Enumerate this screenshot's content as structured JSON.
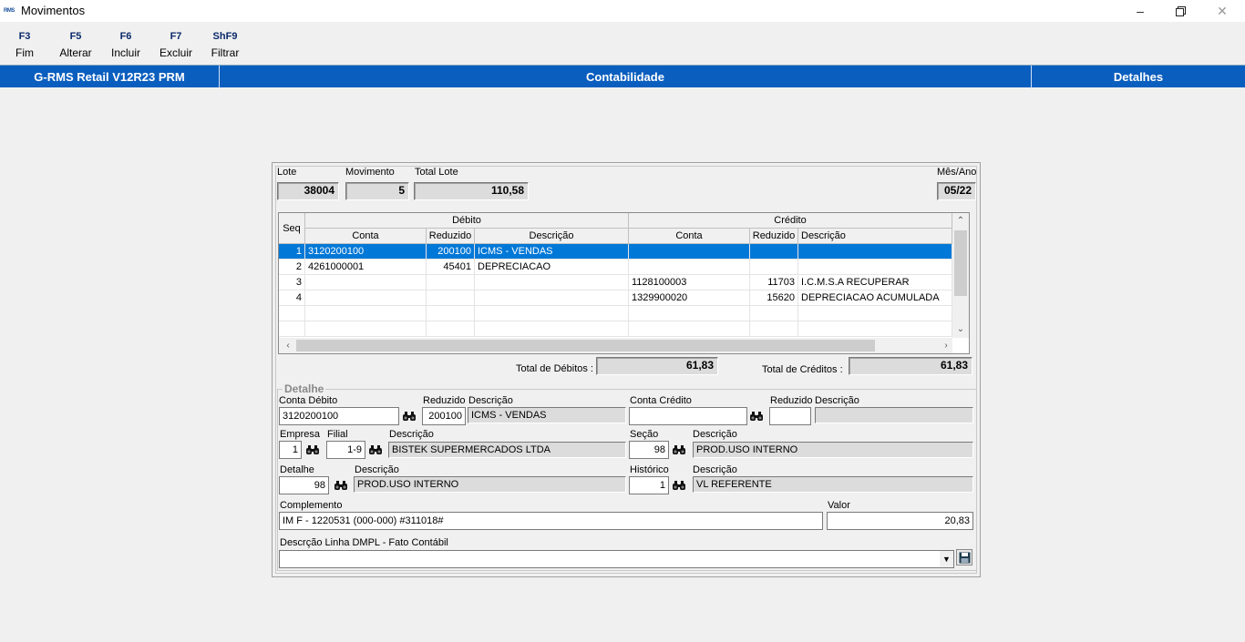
{
  "window": {
    "title": "Movimentos",
    "icon_text": "RMS"
  },
  "toolbar": [
    {
      "key": "F3",
      "label": "Fim"
    },
    {
      "key": "F5",
      "label": "Alterar"
    },
    {
      "key": "F6",
      "label": "Incluir"
    },
    {
      "key": "F7",
      "label": "Excluir"
    },
    {
      "key": "ShF9",
      "label": "Filtrar"
    }
  ],
  "bluebar": {
    "left": "G-RMS Retail V12R23 PRM",
    "center": "Contabilidade",
    "right": "Detalhes"
  },
  "header": {
    "lote_label": "Lote",
    "lote_value": "38004",
    "movimento_label": "Movimento",
    "movimento_value": "5",
    "total_lote_label": "Total Lote",
    "total_lote_value": "110,58",
    "mes_ano_label": "Mês/Ano",
    "mes_ano_value": "05/22"
  },
  "grid": {
    "seq_header": "Seq",
    "debito_header": "Débito",
    "credito_header": "Crédito",
    "sub_headers": {
      "conta": "Conta",
      "reduzido": "Reduzido",
      "descricao": "Descrição"
    },
    "rows": [
      {
        "seq": "1",
        "d_conta": "3120200100",
        "d_red": "200100",
        "d_desc": "ICMS - VENDAS",
        "c_conta": "",
        "c_red": "",
        "c_desc": ""
      },
      {
        "seq": "2",
        "d_conta": "4261000001",
        "d_red": "45401",
        "d_desc": "DEPRECIACAO",
        "c_conta": "",
        "c_red": "",
        "c_desc": ""
      },
      {
        "seq": "3",
        "d_conta": "",
        "d_red": "",
        "d_desc": "",
        "c_conta": "1128100003",
        "c_red": "11703",
        "c_desc": "I.C.M.S.A RECUPERAR"
      },
      {
        "seq": "4",
        "d_conta": "",
        "d_red": "",
        "d_desc": "",
        "c_conta": "1329900020",
        "c_red": "15620",
        "c_desc": "DEPRECIACAO ACUMULADA"
      }
    ]
  },
  "totals": {
    "debitos_label": "Total de Débitos :",
    "debitos_value": "61,83",
    "creditos_label": "Total de Créditos :",
    "creditos_value": "61,83"
  },
  "detalhe": {
    "legend": "Detalhe",
    "conta_debito_label": "Conta Débito",
    "conta_debito": "3120200100",
    "reduzido_label": "Reduzido",
    "reduzido_debito": "200100",
    "descricao_label": "Descrição",
    "descricao_debito": "ICMS - VENDAS",
    "conta_credito_label": "Conta Crédito",
    "conta_credito": "",
    "reduzido_credito": "",
    "descricao_credito": "",
    "empresa_label": "Empresa",
    "empresa": "1",
    "filial_label": "Filial",
    "filial": "1-9",
    "descricao_empresa": "BISTEK SUPERMERCADOS LTDA",
    "secao_label": "Seção",
    "secao": "98",
    "descricao_secao": "PROD.USO INTERNO",
    "detalhe_label": "Detalhe",
    "detalhe": "98",
    "descricao_detalhe": "PROD.USO INTERNO",
    "historico_label": "Histórico",
    "historico": "1",
    "descricao_historico": "VL REFERENTE",
    "complemento_label": "Complemento",
    "complemento": "IM F - 1220531 (000-000) #311018#",
    "valor_label": "Valor",
    "valor": "20,83",
    "dmpl_label": "Descrção Linha DMPL - Fato Contábil",
    "dmpl": ""
  }
}
